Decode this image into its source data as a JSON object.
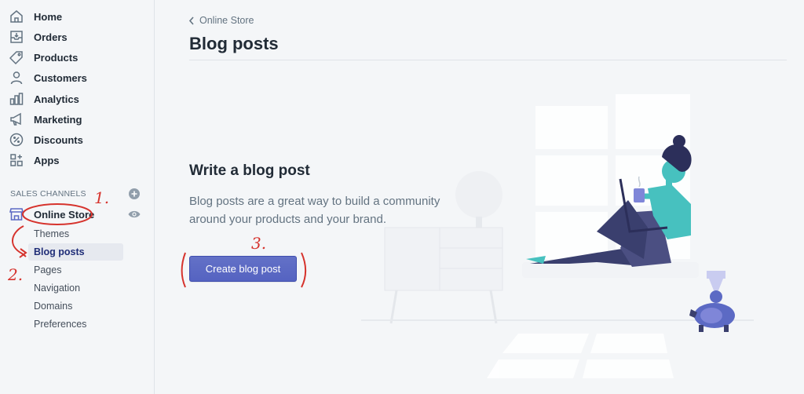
{
  "sidebar": {
    "items": [
      {
        "label": "Home",
        "icon": "home-icon"
      },
      {
        "label": "Orders",
        "icon": "orders-icon"
      },
      {
        "label": "Products",
        "icon": "tag-icon"
      },
      {
        "label": "Customers",
        "icon": "person-icon"
      },
      {
        "label": "Analytics",
        "icon": "bar-chart-icon"
      },
      {
        "label": "Marketing",
        "icon": "megaphone-icon"
      },
      {
        "label": "Discounts",
        "icon": "discount-icon"
      },
      {
        "label": "Apps",
        "icon": "apps-icon"
      }
    ],
    "sales_channels_label": "SALES CHANNELS",
    "online_store_label": "Online Store",
    "sub_items": [
      {
        "label": "Themes",
        "active": false
      },
      {
        "label": "Blog posts",
        "active": true
      },
      {
        "label": "Pages",
        "active": false
      },
      {
        "label": "Navigation",
        "active": false
      },
      {
        "label": "Domains",
        "active": false
      },
      {
        "label": "Preferences",
        "active": false
      }
    ]
  },
  "header": {
    "breadcrumb": "Online Store",
    "title": "Blog posts"
  },
  "empty_state": {
    "heading": "Write a blog post",
    "body": "Blog posts are a great way to build a community around your products and your brand.",
    "button_label": "Create blog post"
  },
  "annotations": [
    "1.",
    "2.",
    "3."
  ],
  "colors": {
    "primary": "#5c6ac4",
    "annotation": "#d6332d",
    "illustration_accent": "#47c1bf",
    "illustration_dark": "#3a3f6e"
  }
}
